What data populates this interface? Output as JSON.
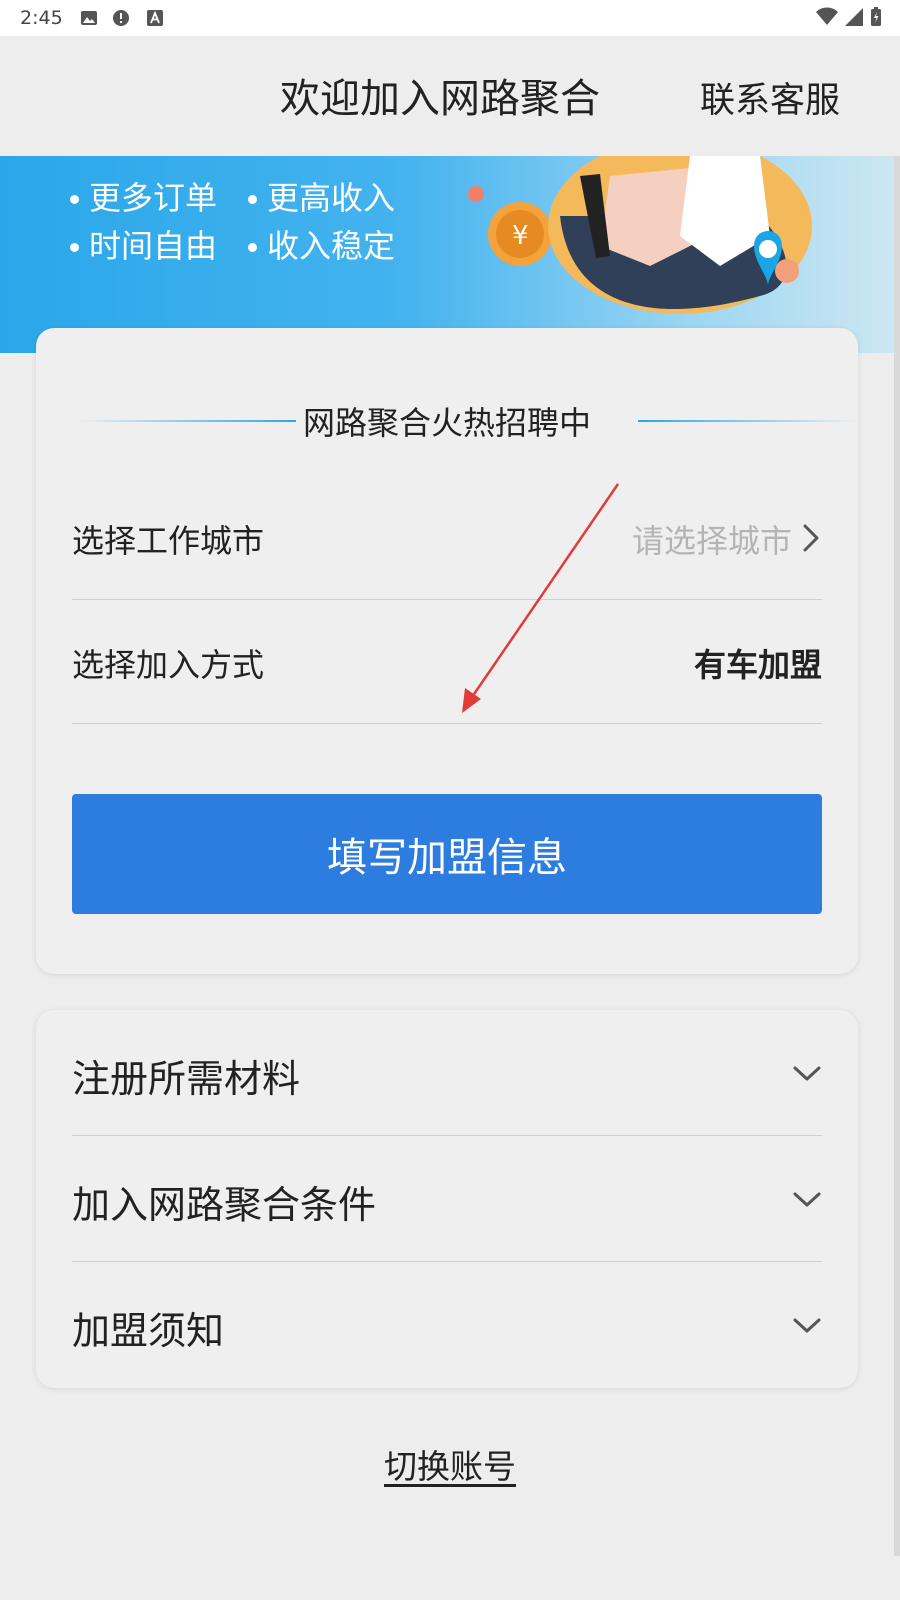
{
  "status_bar": {
    "time": "2:45",
    "icons": [
      "image-icon",
      "alert-icon",
      "font-icon",
      "wifi-icon",
      "signal-icon",
      "battery-icon"
    ]
  },
  "header": {
    "title": "欢迎加入网路聚合",
    "support_link": "联系客服"
  },
  "banner": {
    "perks": [
      "更多订单",
      "更高收入",
      "时间自由",
      "收入稳定"
    ],
    "colors": {
      "start": "#2aa7ea",
      "end": "#cfe7f1"
    }
  },
  "recruit_card": {
    "title": "网路聚合火热招聘中",
    "city_row": {
      "label": "选择工作城市",
      "placeholder": "请选择城市"
    },
    "join_row": {
      "label": "选择加入方式",
      "value": "有车加盟"
    },
    "submit_button": "填写加盟信息"
  },
  "faq_card": {
    "items": [
      {
        "label": "注册所需材料"
      },
      {
        "label": "加入网路聚合条件"
      },
      {
        "label": "加盟须知"
      }
    ]
  },
  "footer": {
    "switch_account": "切换账号"
  },
  "colors": {
    "primary_button": "#2c7ddf",
    "annotation_arrow": "#e03a3a",
    "accent_line": "#2aa7ea"
  }
}
